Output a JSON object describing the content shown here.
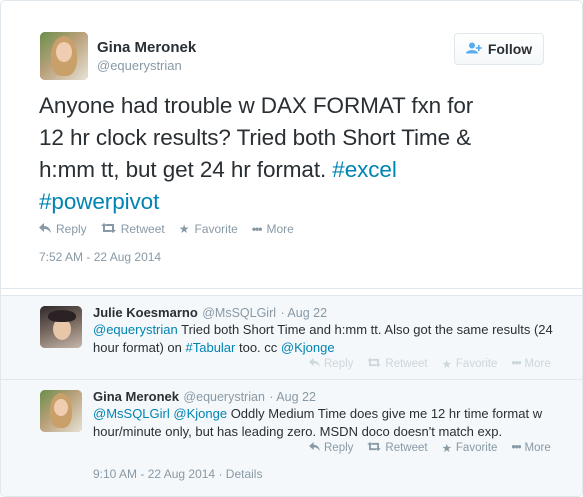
{
  "main_tweet": {
    "author_name": "Gina Meronek",
    "author_handle": "@equerystrian",
    "follow_label": "Follow",
    "text_parts": [
      "Anyone had trouble w DAX FORMAT fxn for",
      "12 hr clock results? Tried both Short Time &",
      "h:mm tt, but get 24 hr format. ",
      "#excel",
      "#powerpivot"
    ],
    "actions": {
      "reply": "Reply",
      "retweet": "Retweet",
      "favorite": "Favorite",
      "more": "More"
    },
    "timestamp": "7:52 AM - 22 Aug 2014"
  },
  "replies": [
    {
      "author_name": "Julie Koesmarno",
      "author_handle": "@MsSQLGirl",
      "date": "· Aug 22",
      "text": {
        "mention1": "@equerystrian",
        "t1": " Tried both Short Time and h:mm tt. Also got the same results (24",
        "t2": "hour format) on ",
        "hashtag": "#Tabular",
        "t3": " too. cc ",
        "mention2": "@Kjonge"
      },
      "actions": {
        "reply": "Reply",
        "retweet": "Retweet",
        "favorite": "Favorite",
        "more": "More"
      }
    },
    {
      "author_name": "Gina Meronek",
      "author_handle": "@equerystrian",
      "date": "· Aug 22",
      "text": {
        "mention1": "@MsSQLGirl",
        "mention2": "@Kjonge",
        "t1": " Oddly Medium Time does give me 12 hr time format w",
        "t2": "hour/minute only, but has leading zero. MSDN doco doesn't match exp."
      },
      "actions": {
        "reply": "Reply",
        "retweet": "Retweet",
        "favorite": "Favorite",
        "more": "More"
      },
      "timestamp": "9:10 AM - 22 Aug 2014",
      "details_label": "Details"
    }
  ],
  "colors": {
    "link": "#0084b4",
    "muted": "#8899a6",
    "text": "#292f33",
    "reply_bg": "#f5f8fa"
  }
}
